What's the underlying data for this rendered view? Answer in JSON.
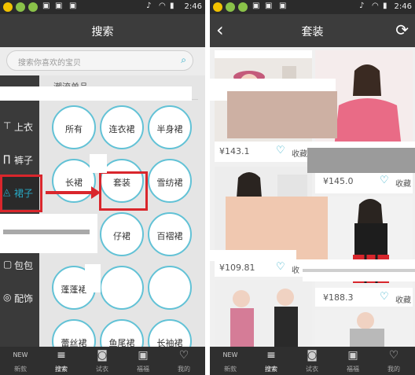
{
  "status_bar": {
    "time": "2:46"
  },
  "left_screen": {
    "title": "搜索",
    "search": {
      "placeholder": "搜索你喜欢的宝贝"
    },
    "sidebar": [
      {
        "label": "上衣",
        "icon": "shirt-icon",
        "glyph": "👕"
      },
      {
        "label": "裤子",
        "icon": "pants-icon",
        "glyph": "👖"
      },
      {
        "label": "裙子",
        "icon": "skirt-icon",
        "glyph": "◬",
        "active": true
      },
      {
        "label": "包包",
        "icon": "bag-icon",
        "glyph": "👜"
      },
      {
        "label": "配饰",
        "icon": "ring-icon",
        "glyph": "◯"
      }
    ],
    "section_title": "潮流单品",
    "categories": [
      "所有",
      "连衣裙",
      "半身裙",
      "长裙",
      "套装",
      "雪纺裙",
      "仔裙",
      "百褶裙",
      "蓬蓬裙",
      "蕾丝裙",
      "鱼尾裙",
      "长袖裙"
    ]
  },
  "right_screen": {
    "title": "套装",
    "products": [
      {
        "price": "¥143.1",
        "fav": "收藏"
      },
      {
        "price": "¥145.0",
        "fav": "收藏"
      },
      {
        "price": "¥109.81",
        "fav": "收"
      },
      {
        "price": "¥188.3",
        "fav": "收藏"
      }
    ]
  },
  "tabs": [
    {
      "label": "新款",
      "icon": "new-badge-icon",
      "glyph": "NEW"
    },
    {
      "label": "搜索",
      "icon": "search-icon",
      "glyph": "≡",
      "active": true
    },
    {
      "label": "试衣",
      "icon": "camera-icon",
      "glyph": "◙"
    },
    {
      "label": "福福",
      "icon": "shopping-bag-icon",
      "glyph": "▣"
    },
    {
      "label": "我的",
      "icon": "heart-icon",
      "glyph": "♡"
    }
  ],
  "colors": {
    "accent": "#28a9c5",
    "highlight": "#d9262c",
    "bar": "#3c3c3c"
  }
}
